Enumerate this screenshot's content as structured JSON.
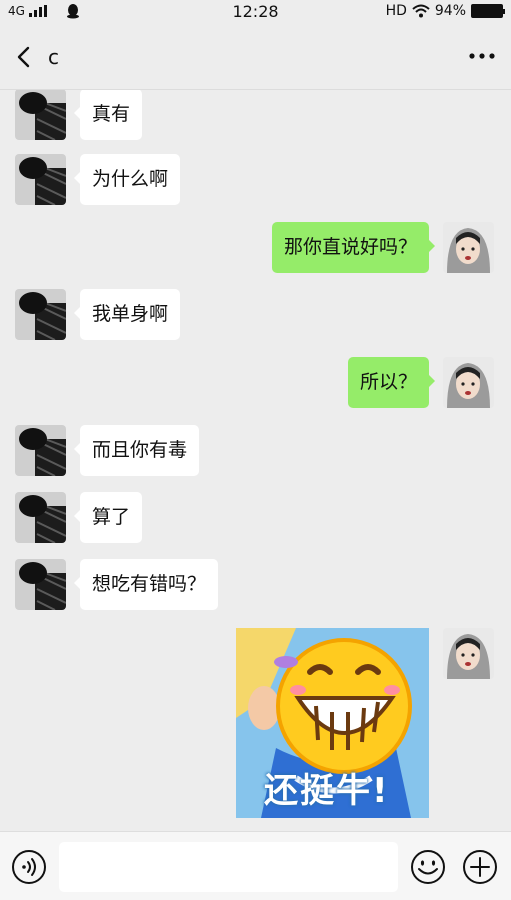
{
  "status_bar": {
    "network": "4G",
    "time": "12:28",
    "hd": "HD",
    "battery": "94%"
  },
  "header": {
    "title": "c"
  },
  "messages": [
    {
      "side": "left",
      "text": "真有"
    },
    {
      "side": "left",
      "text": "为什么啊"
    },
    {
      "side": "right",
      "text": "那你直说好吗？"
    },
    {
      "side": "left",
      "text": "我单身啊"
    },
    {
      "side": "right",
      "text": "所以？"
    },
    {
      "side": "left",
      "text": "而且你有毒"
    },
    {
      "side": "left",
      "text": "算了"
    },
    {
      "side": "left",
      "text": "想吃有错吗？"
    },
    {
      "side": "right",
      "type": "sticker",
      "text": "还挺牛!"
    }
  ],
  "input": {
    "value": "",
    "placeholder": ""
  },
  "icons": {
    "back": "chevron-left-icon",
    "more": "more-icon",
    "voice": "voice-icon",
    "emoji": "emoji-icon",
    "plus": "plus-icon"
  },
  "colors": {
    "background": "#ededed",
    "sent_bubble": "#95ec69",
    "received_bubble": "#ffffff"
  }
}
